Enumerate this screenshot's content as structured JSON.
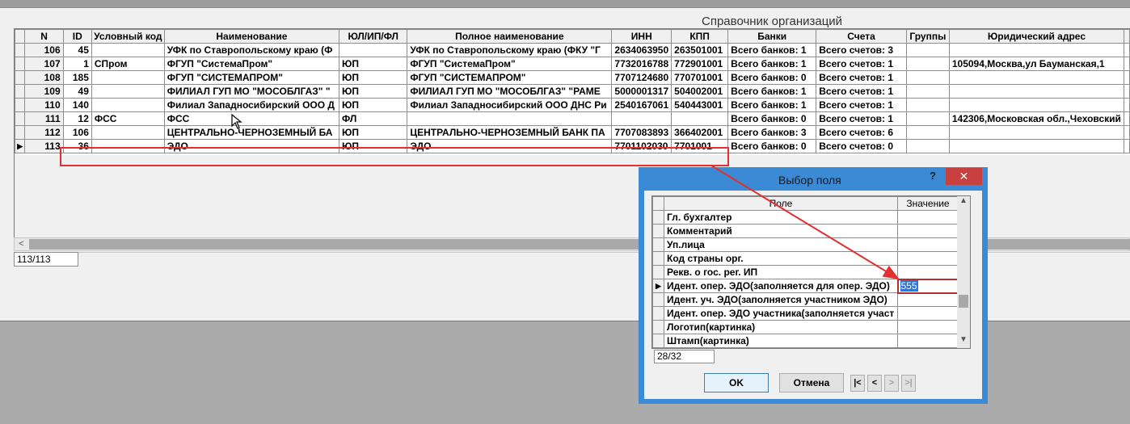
{
  "window": {
    "title": "Справочник организаций"
  },
  "grid": {
    "columns": [
      "N",
      "ID",
      "Условный код",
      "Наименование",
      "ЮЛ/ИП/ФЛ",
      "Полное наименование",
      "ИНН",
      "КПП",
      "Банки",
      "Счета",
      "Группы",
      "Юридический адрес"
    ],
    "rows": [
      [
        "106",
        "45",
        "",
        "УФК по Ставропольскому краю (Ф",
        "",
        "УФК по Ставропольскому краю (ФКУ \"Г",
        "2634063950",
        "263501001",
        "Всего банков: 1",
        "Всего счетов: 3",
        "",
        ""
      ],
      [
        "107",
        "1",
        "СПром",
        "ФГУП \"СистемаПром\"",
        "ЮП",
        "ФГУП \"СистемаПром\"",
        "7732016788",
        "772901001",
        "Всего банков: 1",
        "Всего счетов: 1",
        "",
        "105094,Москва,ул Бауманская,1"
      ],
      [
        "108",
        "185",
        "",
        "ФГУП \"СИСТЕМАПРОМ\"",
        "ЮП",
        "ФГУП \"СИСТЕМАПРОМ\"",
        "7707124680",
        "770701001",
        "Всего банков: 0",
        "Всего счетов: 1",
        "",
        ""
      ],
      [
        "109",
        "49",
        "",
        "ФИЛИАЛ ГУП МО \"МОСОБЛГАЗ\"  \"",
        "ЮП",
        "ФИЛИАЛ ГУП МО \"МОСОБЛГАЗ\"  \"РАМЕ",
        "5000001317",
        "504002001",
        "Всего банков: 1",
        "Всего счетов: 1",
        "",
        ""
      ],
      [
        "110",
        "140",
        "",
        "Филиал Западносибирский ООО Д",
        "ЮП",
        "Филиал Западносибирский ООО ДНС Ри",
        "2540167061",
        "540443001",
        "Всего банков: 1",
        "Всего счетов: 1",
        "",
        ""
      ],
      [
        "111",
        "12",
        "ФСС",
        "ФСС",
        "ФЛ",
        "",
        "",
        "",
        "Всего банков: 0",
        "Всего счетов: 1",
        "",
        "142306,Московская обл.,Чеховский"
      ],
      [
        "112",
        "106",
        "",
        "ЦЕНТРАЛЬНО-ЧЕРНОЗЕМНЫЙ БА",
        "ЮП",
        "ЦЕНТРАЛЬНО-ЧЕРНОЗЕМНЫЙ БАНК ПА",
        "7707083893",
        "366402001",
        "Всего банков: 3",
        "Всего счетов: 6",
        "",
        ""
      ],
      [
        "113",
        "36",
        "",
        "ЭДО",
        "ЮП",
        "ЭДО",
        "7701102030",
        "7701001",
        "Всего банков: 0",
        "Всего счетов: 0",
        "",
        ""
      ]
    ],
    "current_row_marker": "▶",
    "counter": "113/113"
  },
  "dialog": {
    "title": "Выбор поля",
    "help": "?",
    "close": "✕",
    "columns": [
      "Поле",
      "Значение"
    ],
    "rows": [
      {
        "field": "Гл. бухгалтер",
        "value": ""
      },
      {
        "field": "Комментарий",
        "value": ""
      },
      {
        "field": "Уп.лица",
        "value": ""
      },
      {
        "field": "Код страны орг.",
        "value": ""
      },
      {
        "field": "Рекв. о гос. рег. ИП",
        "value": ""
      },
      {
        "field": "Идент. опер. ЭДО(заполняется для опер. ЭДО)",
        "value": "555"
      },
      {
        "field": "Идент. уч. ЭДО(заполняется участником ЭДО)",
        "value": ""
      },
      {
        "field": "Идент. опер. ЭДО участника(заполняется участ",
        "value": ""
      },
      {
        "field": "Логотип(картинка)",
        "value": ""
      },
      {
        "field": "Штамп(картинка)",
        "value": ""
      }
    ],
    "current_row_marker": "▶",
    "counter": "28/32",
    "ok_label": "OK",
    "cancel_label": "Отмена",
    "nav": [
      "|<",
      "<",
      ">",
      ">|"
    ]
  },
  "colors": {
    "highlight": "#e03030",
    "selection": "#3074d8",
    "dialog_frame": "#3b8ad6",
    "close_button": "#c94040"
  },
  "icons": {
    "cursor": "mouse-pointer-icon"
  }
}
